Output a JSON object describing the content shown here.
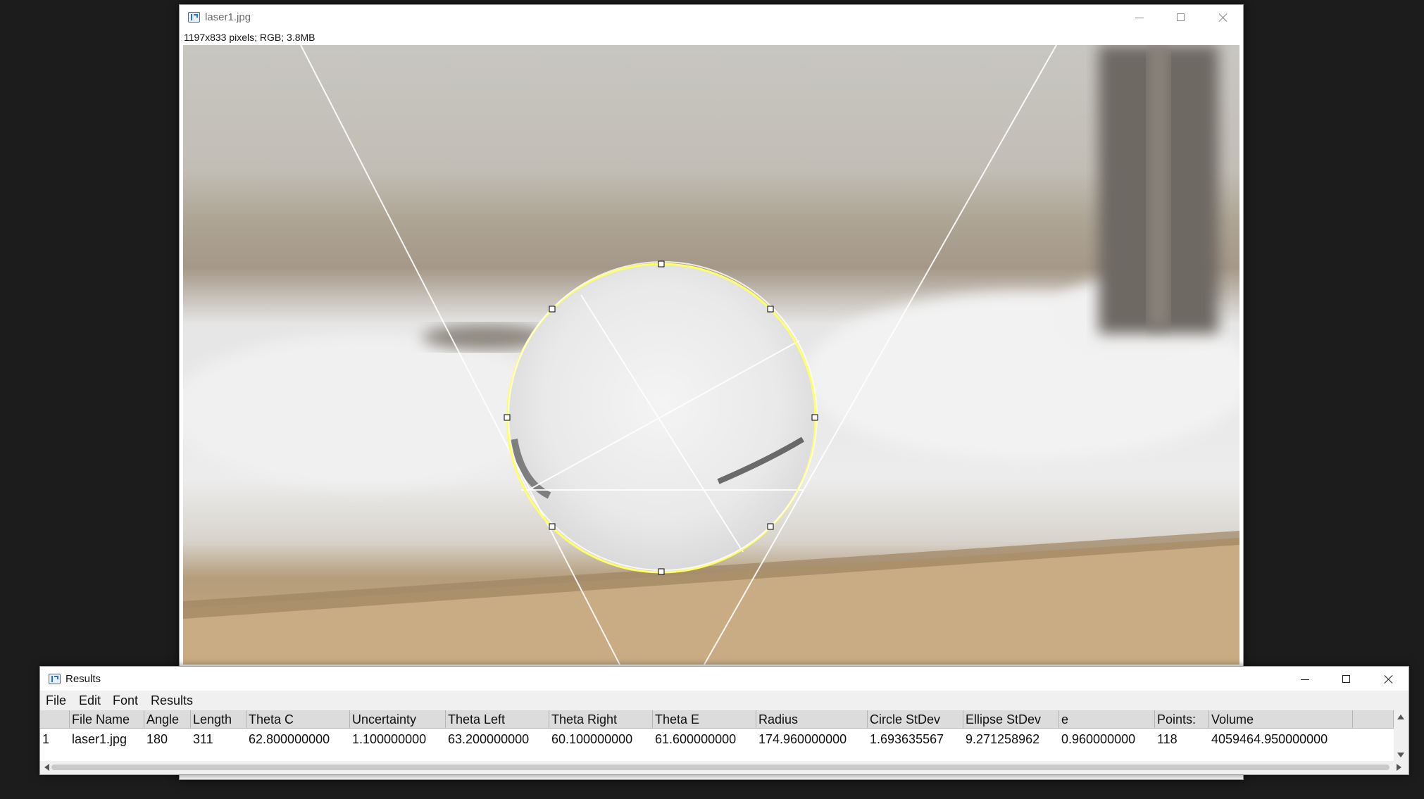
{
  "image_window": {
    "title": "laser1.jpg",
    "info": "1197x833 pixels; RGB; 3.8MB",
    "controls": {
      "minimize": "minimize-icon",
      "maximize": "maximize-icon",
      "close": "close-icon"
    }
  },
  "results_window": {
    "title": "Results",
    "menu": [
      "File",
      "Edit",
      "Font",
      "Results"
    ],
    "headers": [
      "",
      "File Name",
      "Angle",
      "Length",
      "Theta C",
      "Uncertainty",
      "Theta Left",
      "Theta Right",
      "Theta E",
      "Radius",
      "Circle StDev",
      "Ellipse StDev",
      "e",
      "Points:",
      "Volume"
    ],
    "rows": [
      [
        "1",
        "laser1.jpg",
        "180",
        "311",
        "62.800000000",
        "1.100000000",
        "63.200000000",
        "60.100000000",
        "61.600000000",
        "174.960000000",
        "1.693635567",
        "9.271258962",
        "0.960000000",
        "118",
        "4059464.950000000"
      ]
    ]
  },
  "colors": {
    "accent": "#2f6fc4",
    "selection": "#ffff66",
    "background": "#1c1c1c"
  }
}
